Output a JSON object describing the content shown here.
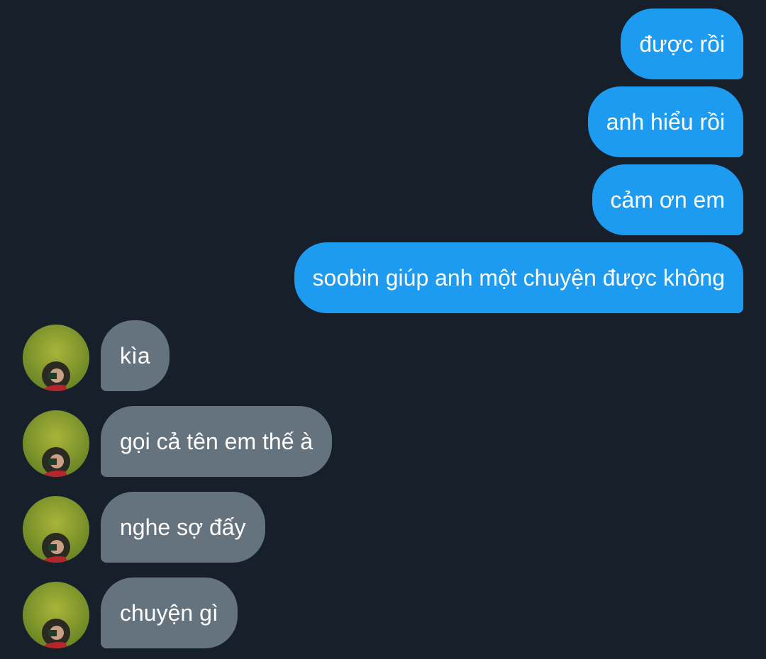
{
  "conversation": {
    "outgoing": [
      {
        "text": "được rồi"
      },
      {
        "text": "anh hiểu rồi"
      },
      {
        "text": "cảm ơn em"
      },
      {
        "text": "soobin giúp anh một chuyện được không"
      }
    ],
    "incoming": [
      {
        "text": "kìa",
        "avatar_icon": "contact-avatar"
      },
      {
        "text": "gọi cả tên em thế à",
        "avatar_icon": "contact-avatar"
      },
      {
        "text": "nghe sợ đấy",
        "avatar_icon": "contact-avatar"
      },
      {
        "text": "chuyện gì",
        "avatar_icon": "contact-avatar"
      }
    ]
  },
  "colors": {
    "background": "#17202a",
    "outgoing_bubble": "#1d9bf0",
    "incoming_bubble": "#65737f",
    "text": "#ffffff"
  }
}
